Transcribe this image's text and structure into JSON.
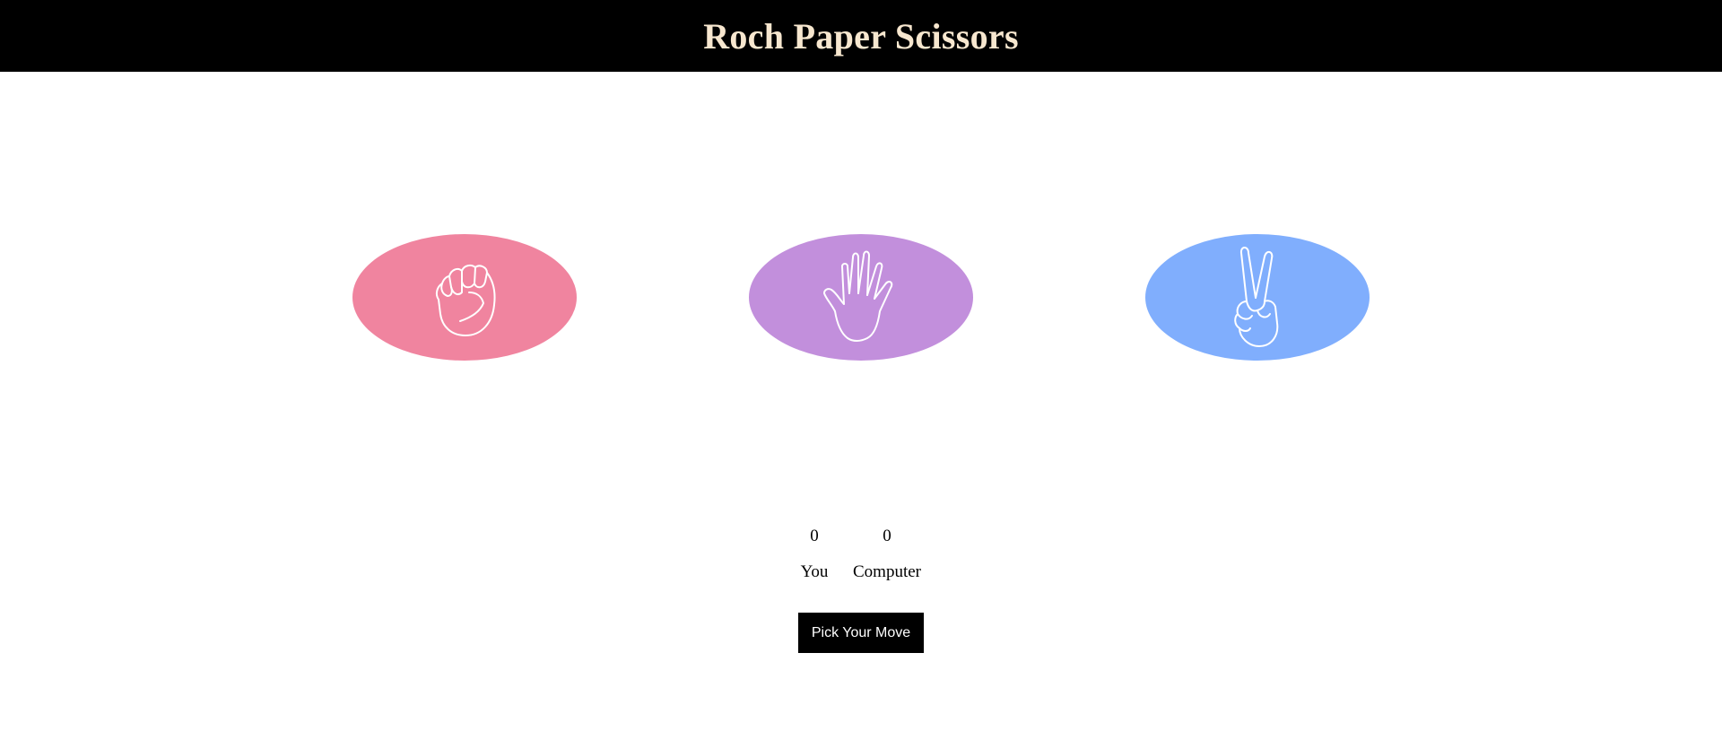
{
  "header": {
    "title": "Roch Paper Scissors"
  },
  "choices": [
    {
      "name": "rock",
      "icon": "fist-icon",
      "color": "#f0849f"
    },
    {
      "name": "paper",
      "icon": "open-hand-icon",
      "color": "#c28fdc"
    },
    {
      "name": "scissors",
      "icon": "peace-hand-icon",
      "color": "#80aefd"
    }
  ],
  "score": {
    "you_value": "0",
    "computer_value": "0",
    "you_label": "You",
    "computer_label": "Computer"
  },
  "action": {
    "button_label": "Pick Your Move"
  },
  "colors": {
    "header_bg": "#000000",
    "title_color": "#f7e7cf",
    "rock": "#f0849f",
    "paper": "#c28fdc",
    "scissors": "#80aefd",
    "button_bg": "#000000",
    "button_text": "#ffffff"
  }
}
